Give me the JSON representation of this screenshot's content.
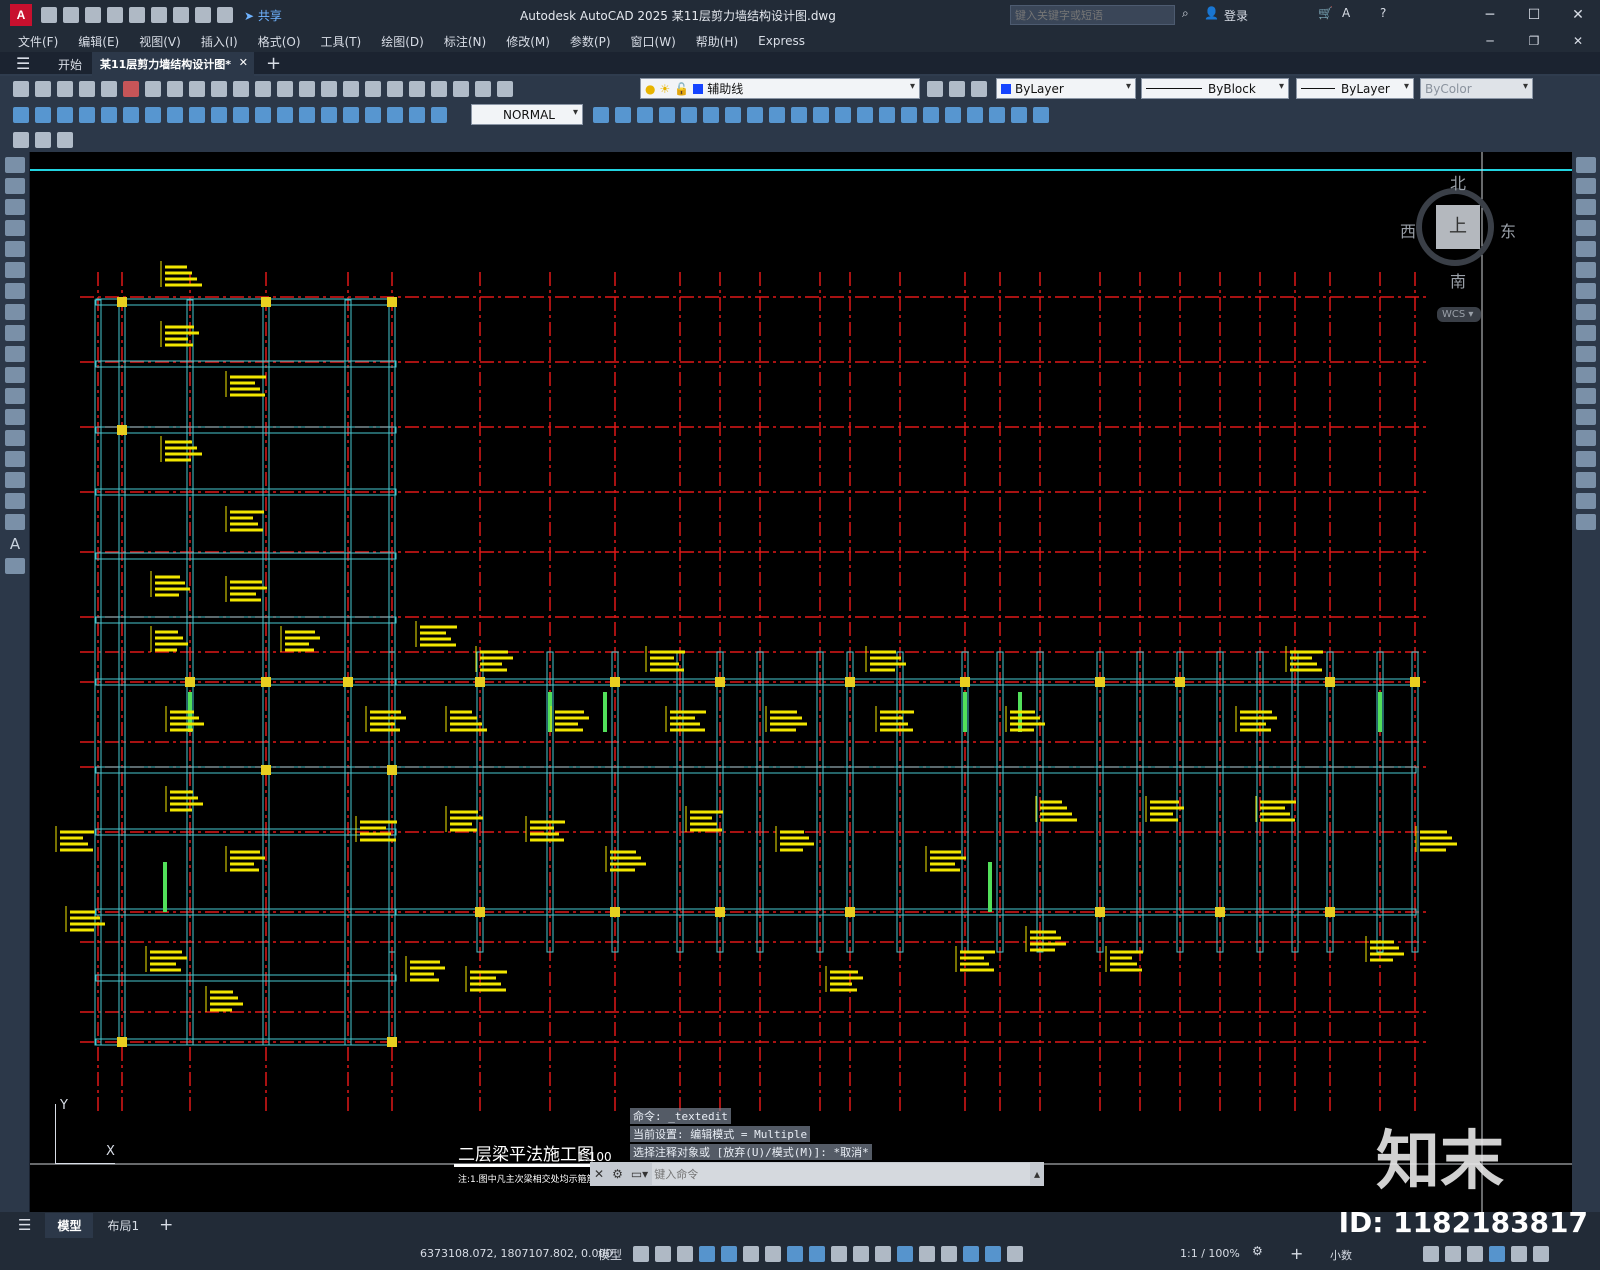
{
  "titlebar": {
    "app_icon": "A",
    "share_label": "共享",
    "title": "Autodesk AutoCAD 2025    某11层剪力墙结构设计图.dwg",
    "search_placeholder": "键入关键字或短语",
    "login_label": "登录"
  },
  "menubar": {
    "items": [
      "文件(F)",
      "编辑(E)",
      "视图(V)",
      "插入(I)",
      "格式(O)",
      "工具(T)",
      "绘图(D)",
      "标注(N)",
      "修改(M)",
      "参数(P)",
      "窗口(W)",
      "帮助(H)",
      "Express"
    ]
  },
  "tabs": [
    {
      "label": "开始"
    },
    {
      "label": "某11层剪力墙结构设计图*"
    }
  ],
  "toolbar": {
    "layer": "辅助线",
    "color": "ByLayer",
    "linetype": "ByBlock",
    "lineweight": "ByLayer",
    "plotstyle": "ByColor",
    "textstyle": "NORMAL"
  },
  "viewcube": {
    "north": "北",
    "south": "南",
    "west": "西",
    "east": "东",
    "face": "上",
    "wcs": "WCS"
  },
  "drawing": {
    "title": "二层梁平法施工图",
    "scale": "1:100",
    "note": "注:1.图中凡主次梁相交处均示箍筋",
    "ucs_y": "Y",
    "ucs_x": "X"
  },
  "command": {
    "history": [
      "命令: _textedit",
      "当前设置: 编辑模式 = Multiple",
      "选择注释对象或 [放弃(U)/模式(M)]: *取消*"
    ],
    "placeholder": "键入命令"
  },
  "layout_tabs": [
    {
      "label": "模型"
    },
    {
      "label": "布局1"
    }
  ],
  "statusbar": {
    "coords": "6373108.072, 1807107.802, 0.000",
    "model_label": "模型",
    "scale": "1:1 / 100%",
    "units": "小数"
  },
  "watermark": {
    "brand": "知末",
    "id": "ID: 1182183817"
  }
}
